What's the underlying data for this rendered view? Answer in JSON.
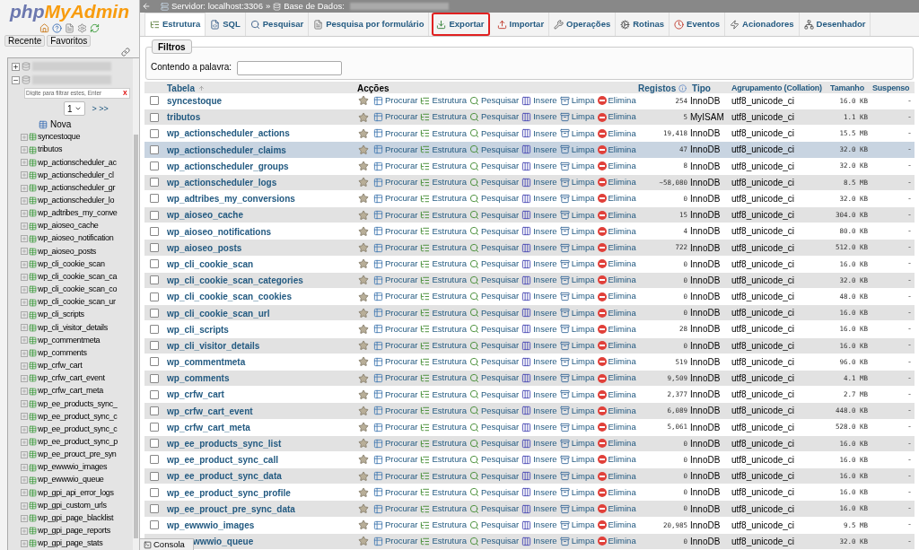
{
  "sidebar": {
    "logo": {
      "php": "php",
      "myadmin": "MyAdmin"
    },
    "buttons": [
      "Recente",
      "Favoritos"
    ],
    "databases": [
      {
        "expanded": false
      },
      {
        "expanded": true
      }
    ],
    "filter": {
      "placeholder": "Digite para filtrar estes, Enter",
      "clear": "X"
    },
    "pager": {
      "page": "1",
      "next": "> >>"
    },
    "new_item": "Nova",
    "tables": [
      "syncestoque",
      "tributos",
      "wp_actionscheduler_ac",
      "wp_actionscheduler_cl",
      "wp_actionscheduler_gr",
      "wp_actionscheduler_lo",
      "wp_adtribes_my_conve",
      "wp_aioseo_cache",
      "wp_aioseo_notification",
      "wp_aioseo_posts",
      "wp_cli_cookie_scan",
      "wp_cli_cookie_scan_ca",
      "wp_cli_cookie_scan_co",
      "wp_cli_cookie_scan_ur",
      "wp_cli_scripts",
      "wp_cli_visitor_details",
      "wp_commentmeta",
      "wp_comments",
      "wp_crfw_cart",
      "wp_crfw_cart_event",
      "wp_crfw_cart_meta",
      "wp_ee_products_sync_",
      "wp_ee_product_sync_c",
      "wp_ee_product_sync_c",
      "wp_ee_product_sync_p",
      "wp_ee_prouct_pre_syn",
      "wp_ewwwio_images",
      "wp_ewwwio_queue",
      "wp_gpi_api_error_logs",
      "wp_gpi_custom_urls",
      "wp_gpi_page_blacklist",
      "wp_gpi_page_reports",
      "wp_gpi_page_stats"
    ]
  },
  "breadcrumb": {
    "server": "Servidor: localhost:3306",
    "separator": "»",
    "database": "Base de Dados:"
  },
  "tabs": [
    {
      "label": "Estrutura",
      "selected": true,
      "outlined": false
    },
    {
      "label": "SQL",
      "selected": false,
      "outlined": false
    },
    {
      "label": "Pesquisar",
      "selected": false,
      "outlined": false
    },
    {
      "label": "Pesquisa por formulário",
      "selected": false,
      "outlined": false
    },
    {
      "label": "Exportar",
      "selected": false,
      "outlined": true
    },
    {
      "label": "Importar",
      "selected": false,
      "outlined": false
    },
    {
      "label": "Operações",
      "selected": false,
      "outlined": false
    },
    {
      "label": "Rotinas",
      "selected": false,
      "outlined": false
    },
    {
      "label": "Eventos",
      "selected": false,
      "outlined": false
    },
    {
      "label": "Acionadores",
      "selected": false,
      "outlined": false
    },
    {
      "label": "Desenhador",
      "selected": false,
      "outlined": false
    }
  ],
  "filters": {
    "legend": "Filtros",
    "label": "Contendo a palavra:"
  },
  "table": {
    "columns": [
      "Tabela",
      "Acções",
      "Registos",
      "Tipo",
      "Agrupamento (Collation)",
      "Tamanho",
      "Suspenso"
    ],
    "rows": [
      {
        "name": "syncestoque",
        "actions": [
          "Procurar",
          "Estrutura",
          "Pesquisar",
          "Insere",
          "Limpa",
          "Elimina"
        ],
        "records": "254",
        "type": "InnoDB",
        "collation": "utf8_unicode_ci",
        "size": "16.0 KB",
        "overhead": "-",
        "checked": false,
        "highlighted": false
      },
      {
        "name": "tributos",
        "actions": [
          "Procurar",
          "Estrutura",
          "Pesquisar",
          "Insere",
          "Limpa",
          "Elimina"
        ],
        "records": "5",
        "type": "MyISAM",
        "collation": "utf8_unicode_ci",
        "size": "1.1 KB",
        "overhead": "-",
        "checked": false,
        "highlighted": false
      },
      {
        "name": "wp_actionscheduler_actions",
        "actions": [
          "Procurar",
          "Estrutura",
          "Pesquisar",
          "Insere",
          "Limpa",
          "Elimina"
        ],
        "records": "19,418",
        "type": "InnoDB",
        "collation": "utf8_unicode_ci",
        "size": "15.5 MB",
        "overhead": "-",
        "checked": false,
        "highlighted": false
      },
      {
        "name": "wp_actionscheduler_claims",
        "actions": [
          "Procurar",
          "Estrutura",
          "Pesquisar",
          "Insere",
          "Limpa",
          "Elimina"
        ],
        "records": "47",
        "type": "InnoDB",
        "collation": "utf8_unicode_ci",
        "size": "32.0 KB",
        "overhead": "-",
        "checked": false,
        "highlighted": true
      },
      {
        "name": "wp_actionscheduler_groups",
        "actions": [
          "Procurar",
          "Estrutura",
          "Pesquisar",
          "Insere",
          "Limpa",
          "Elimina"
        ],
        "records": "8",
        "type": "InnoDB",
        "collation": "utf8_unicode_ci",
        "size": "32.0 KB",
        "overhead": "-",
        "checked": false,
        "highlighted": false
      },
      {
        "name": "wp_actionscheduler_logs",
        "actions": [
          "Procurar",
          "Estrutura",
          "Pesquisar",
          "Insere",
          "Limpa",
          "Elimina"
        ],
        "records": "~58,080",
        "type": "InnoDB",
        "collation": "utf8_unicode_ci",
        "size": "8.5 MB",
        "overhead": "-",
        "checked": false,
        "highlighted": false
      },
      {
        "name": "wp_adtribes_my_conversions",
        "actions": [
          "Procurar",
          "Estrutura",
          "Pesquisar",
          "Insere",
          "Limpa",
          "Elimina"
        ],
        "records": "0",
        "type": "InnoDB",
        "collation": "utf8_unicode_ci",
        "size": "32.0 KB",
        "overhead": "-",
        "checked": false,
        "highlighted": false
      },
      {
        "name": "wp_aioseo_cache",
        "actions": [
          "Procurar",
          "Estrutura",
          "Pesquisar",
          "Insere",
          "Limpa",
          "Elimina"
        ],
        "records": "15",
        "type": "InnoDB",
        "collation": "utf8_unicode_ci",
        "size": "304.0 KB",
        "overhead": "-",
        "checked": false,
        "highlighted": false
      },
      {
        "name": "wp_aioseo_notifications",
        "actions": [
          "Procurar",
          "Estrutura",
          "Pesquisar",
          "Insere",
          "Limpa",
          "Elimina"
        ],
        "records": "4",
        "type": "InnoDB",
        "collation": "utf8_unicode_ci",
        "size": "80.0 KB",
        "overhead": "-",
        "checked": false,
        "highlighted": false
      },
      {
        "name": "wp_aioseo_posts",
        "actions": [
          "Procurar",
          "Estrutura",
          "Pesquisar",
          "Insere",
          "Limpa",
          "Elimina"
        ],
        "records": "722",
        "type": "InnoDB",
        "collation": "utf8_unicode_ci",
        "size": "512.0 KB",
        "overhead": "-",
        "checked": false,
        "highlighted": false
      },
      {
        "name": "wp_cli_cookie_scan",
        "actions": [
          "Procurar",
          "Estrutura",
          "Pesquisar",
          "Insere",
          "Limpa",
          "Elimina"
        ],
        "records": "0",
        "type": "InnoDB",
        "collation": "utf8_unicode_ci",
        "size": "16.0 KB",
        "overhead": "-",
        "checked": false,
        "highlighted": false
      },
      {
        "name": "wp_cli_cookie_scan_categories",
        "actions": [
          "Procurar",
          "Estrutura",
          "Pesquisar",
          "Insere",
          "Limpa",
          "Elimina"
        ],
        "records": "0",
        "type": "InnoDB",
        "collation": "utf8_unicode_ci",
        "size": "32.0 KB",
        "overhead": "-",
        "checked": false,
        "highlighted": false
      },
      {
        "name": "wp_cli_cookie_scan_cookies",
        "actions": [
          "Procurar",
          "Estrutura",
          "Pesquisar",
          "Insere",
          "Limpa",
          "Elimina"
        ],
        "records": "0",
        "type": "InnoDB",
        "collation": "utf8_unicode_ci",
        "size": "48.0 KB",
        "overhead": "-",
        "checked": false,
        "highlighted": false
      },
      {
        "name": "wp_cli_cookie_scan_url",
        "actions": [
          "Procurar",
          "Estrutura",
          "Pesquisar",
          "Insere",
          "Limpa",
          "Elimina"
        ],
        "records": "0",
        "type": "InnoDB",
        "collation": "utf8_unicode_ci",
        "size": "16.0 KB",
        "overhead": "-",
        "checked": false,
        "highlighted": false
      },
      {
        "name": "wp_cli_scripts",
        "actions": [
          "Procurar",
          "Estrutura",
          "Pesquisar",
          "Insere",
          "Limpa",
          "Elimina"
        ],
        "records": "28",
        "type": "InnoDB",
        "collation": "utf8_unicode_ci",
        "size": "16.0 KB",
        "overhead": "-",
        "checked": false,
        "highlighted": false
      },
      {
        "name": "wp_cli_visitor_details",
        "actions": [
          "Procurar",
          "Estrutura",
          "Pesquisar",
          "Insere",
          "Limpa",
          "Elimina"
        ],
        "records": "0",
        "type": "InnoDB",
        "collation": "utf8_unicode_ci",
        "size": "16.0 KB",
        "overhead": "-",
        "checked": false,
        "highlighted": false
      },
      {
        "name": "wp_commentmeta",
        "actions": [
          "Procurar",
          "Estrutura",
          "Pesquisar",
          "Insere",
          "Limpa",
          "Elimina"
        ],
        "records": "519",
        "type": "InnoDB",
        "collation": "utf8_unicode_ci",
        "size": "96.0 KB",
        "overhead": "-",
        "checked": false,
        "highlighted": false
      },
      {
        "name": "wp_comments",
        "actions": [
          "Procurar",
          "Estrutura",
          "Pesquisar",
          "Insere",
          "Limpa",
          "Elimina"
        ],
        "records": "9,509",
        "type": "InnoDB",
        "collation": "utf8_unicode_ci",
        "size": "4.1 MB",
        "overhead": "-",
        "checked": false,
        "highlighted": false
      },
      {
        "name": "wp_crfw_cart",
        "actions": [
          "Procurar",
          "Estrutura",
          "Pesquisar",
          "Insere",
          "Limpa",
          "Elimina"
        ],
        "records": "2,377",
        "type": "InnoDB",
        "collation": "utf8_unicode_ci",
        "size": "2.7 MB",
        "overhead": "-",
        "checked": false,
        "highlighted": false
      },
      {
        "name": "wp_crfw_cart_event",
        "actions": [
          "Procurar",
          "Estrutura",
          "Pesquisar",
          "Insere",
          "Limpa",
          "Elimina"
        ],
        "records": "6,089",
        "type": "InnoDB",
        "collation": "utf8_unicode_ci",
        "size": "448.0 KB",
        "overhead": "-",
        "checked": false,
        "highlighted": false
      },
      {
        "name": "wp_crfw_cart_meta",
        "actions": [
          "Procurar",
          "Estrutura",
          "Pesquisar",
          "Insere",
          "Limpa",
          "Elimina"
        ],
        "records": "5,061",
        "type": "InnoDB",
        "collation": "utf8_unicode_ci",
        "size": "528.0 KB",
        "overhead": "-",
        "checked": false,
        "highlighted": false
      },
      {
        "name": "wp_ee_products_sync_list",
        "actions": [
          "Procurar",
          "Estrutura",
          "Pesquisar",
          "Insere",
          "Limpa",
          "Elimina"
        ],
        "records": "0",
        "type": "InnoDB",
        "collation": "utf8_unicode_ci",
        "size": "16.0 KB",
        "overhead": "-",
        "checked": false,
        "highlighted": false
      },
      {
        "name": "wp_ee_product_sync_call",
        "actions": [
          "Procurar",
          "Estrutura",
          "Pesquisar",
          "Insere",
          "Limpa",
          "Elimina"
        ],
        "records": "0",
        "type": "InnoDB",
        "collation": "utf8_unicode_ci",
        "size": "16.0 KB",
        "overhead": "-",
        "checked": false,
        "highlighted": false
      },
      {
        "name": "wp_ee_product_sync_data",
        "actions": [
          "Procurar",
          "Estrutura",
          "Pesquisar",
          "Insere",
          "Limpa",
          "Elimina"
        ],
        "records": "0",
        "type": "InnoDB",
        "collation": "utf8_unicode_ci",
        "size": "16.0 KB",
        "overhead": "-",
        "checked": false,
        "highlighted": false
      },
      {
        "name": "wp_ee_product_sync_profile",
        "actions": [
          "Procurar",
          "Estrutura",
          "Pesquisar",
          "Insere",
          "Limpa",
          "Elimina"
        ],
        "records": "0",
        "type": "InnoDB",
        "collation": "utf8_unicode_ci",
        "size": "16.0 KB",
        "overhead": "-",
        "checked": false,
        "highlighted": false
      },
      {
        "name": "wp_ee_prouct_pre_sync_data",
        "actions": [
          "Procurar",
          "Estrutura",
          "Pesquisar",
          "Insere",
          "Limpa",
          "Elimina"
        ],
        "records": "0",
        "type": "InnoDB",
        "collation": "utf8_unicode_ci",
        "size": "16.0 KB",
        "overhead": "-",
        "checked": false,
        "highlighted": false
      },
      {
        "name": "wp_ewwwio_images",
        "actions": [
          "Procurar",
          "Estrutura",
          "Pesquisar",
          "Insere",
          "Limpa",
          "Elimina"
        ],
        "records": "20,985",
        "type": "InnoDB",
        "collation": "utf8_unicode_ci",
        "size": "9.5 MB",
        "overhead": "-",
        "checked": false,
        "highlighted": false
      },
      {
        "name": "wwwio_queue",
        "actions": [
          "Procurar",
          "Estrutura",
          "Pesquisar",
          "Insere",
          "Limpa",
          "Elimina"
        ],
        "records": "0",
        "type": "InnoDB",
        "collation": "utf8_unicode_ci",
        "size": "32.0 KB",
        "overhead": "-",
        "highlighted": false
      }
    ]
  },
  "console": "Consola"
}
